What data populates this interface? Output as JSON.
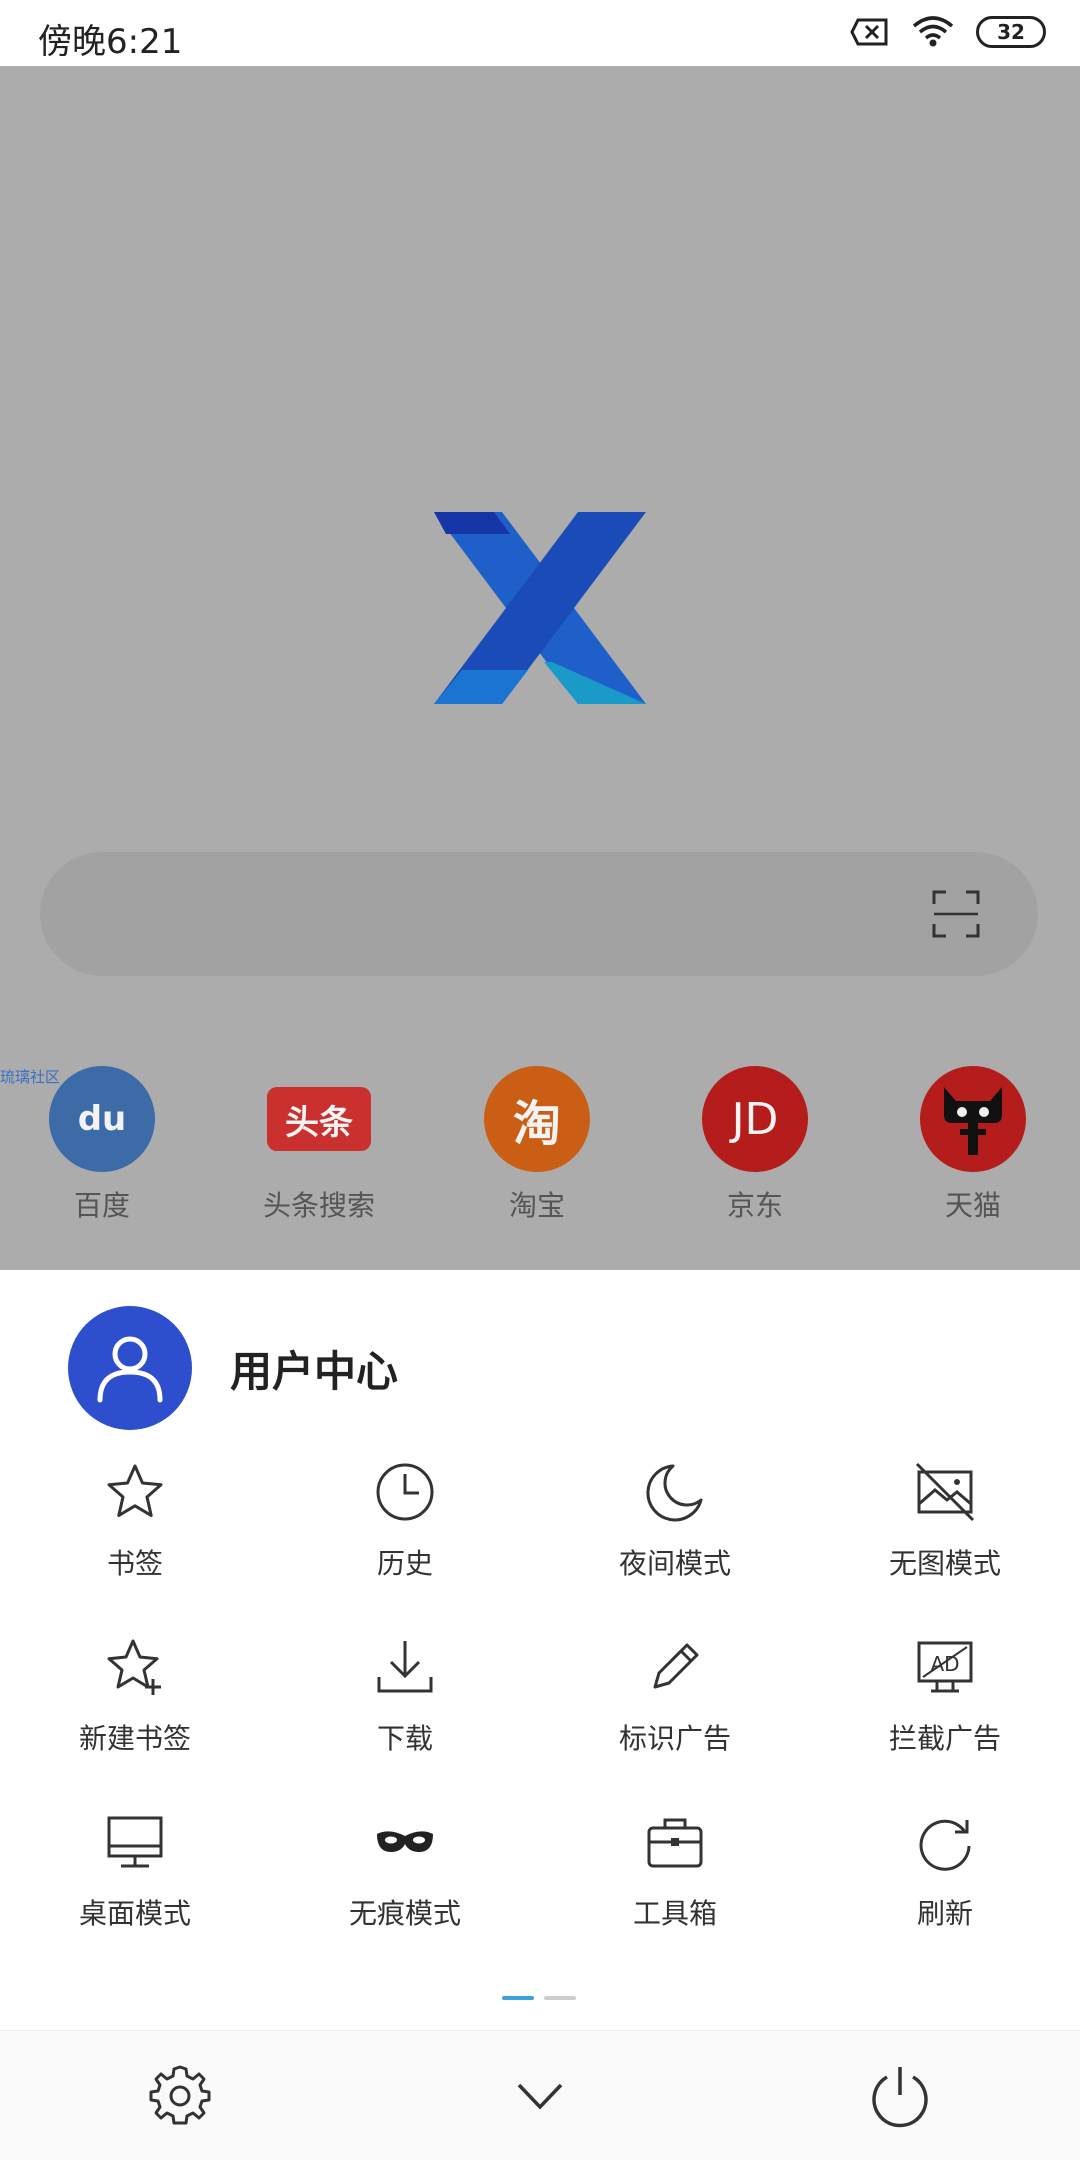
{
  "status_bar": {
    "time": "傍晚6:21",
    "battery": "32"
  },
  "home": {
    "watermark": "琉璃社区",
    "quick_links": [
      {
        "label": "百度",
        "badge": "du",
        "color": "#3c6ba8"
      },
      {
        "label": "头条搜索",
        "badge": "头条",
        "color": "#c9302e"
      },
      {
        "label": "淘宝",
        "badge": "淘",
        "color": "#c95e14"
      },
      {
        "label": "京东",
        "badge": "JD",
        "color": "#b51d1d"
      },
      {
        "label": "天猫",
        "badge": "天猫",
        "color": "#b51d1d"
      }
    ]
  },
  "panel": {
    "user_center": "用户中心",
    "menu": [
      {
        "label": "书签",
        "icon": "star-icon"
      },
      {
        "label": "历史",
        "icon": "clock-icon"
      },
      {
        "label": "夜间模式",
        "icon": "moon-icon"
      },
      {
        "label": "无图模式",
        "icon": "no-image-icon"
      },
      {
        "label": "新建书签",
        "icon": "star-plus-icon"
      },
      {
        "label": "下载",
        "icon": "download-icon"
      },
      {
        "label": "标识广告",
        "icon": "pencil-icon"
      },
      {
        "label": "拦截广告",
        "icon": "ad-block-icon"
      },
      {
        "label": "桌面模式",
        "icon": "monitor-icon"
      },
      {
        "label": "无痕模式",
        "icon": "mask-icon"
      },
      {
        "label": "工具箱",
        "icon": "toolbox-icon"
      },
      {
        "label": "刷新",
        "icon": "refresh-icon"
      }
    ],
    "pager": {
      "active_color": "#3aa3dd",
      "inactive_color": "#cccccc"
    }
  },
  "colors": {
    "accent": "#2d4fce",
    "dim_overlay": "#acacac"
  }
}
